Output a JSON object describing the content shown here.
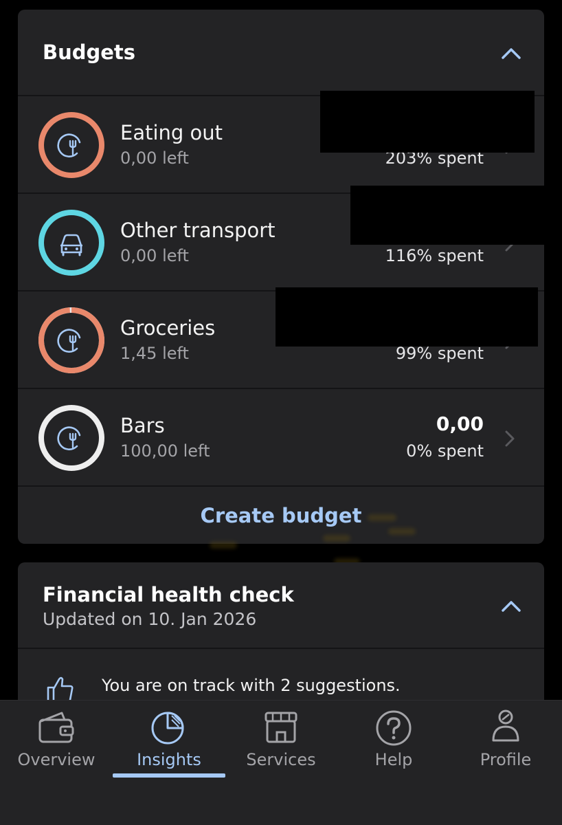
{
  "budgets": {
    "title": "Budgets",
    "items": [
      {
        "name": "Eating out",
        "left": "0,00 left",
        "amount": "",
        "spent": "203% spent",
        "icon": "cutlery-icon",
        "ring_color": "#e9886b",
        "progress": 1.0,
        "redacted": true
      },
      {
        "name": "Other transport",
        "left": "0,00 left",
        "amount": "",
        "spent": "116% spent",
        "icon": "car-icon",
        "ring_color": "#5ed6e3",
        "progress": 1.0,
        "redacted": true
      },
      {
        "name": "Groceries",
        "left": "1,45 left",
        "amount": "",
        "spent": "99% spent",
        "icon": "cutlery-icon",
        "ring_color": "#e9886b",
        "progress": 0.99,
        "redacted": true
      },
      {
        "name": "Bars",
        "left": "100,00 left",
        "amount": "0,00",
        "spent": "0% spent",
        "icon": "cutlery-icon",
        "ring_color": "#eeeeee",
        "progress": 0.0,
        "redacted": false
      }
    ],
    "create_label": "Create budget"
  },
  "health": {
    "title": "Financial health check",
    "updated": "Updated on 10. Jan 2026",
    "message": "You are on track with 2 suggestions."
  },
  "nav": {
    "active": "Insights",
    "items": [
      {
        "label": "Overview",
        "icon": "wallet-icon"
      },
      {
        "label": "Insights",
        "icon": "pie-chart-icon"
      },
      {
        "label": "Services",
        "icon": "store-icon"
      },
      {
        "label": "Help",
        "icon": "help-icon"
      },
      {
        "label": "Profile",
        "icon": "profile-icon"
      }
    ]
  },
  "colors": {
    "accent": "#a6c9f5",
    "card": "#232325",
    "background": "#000000"
  }
}
